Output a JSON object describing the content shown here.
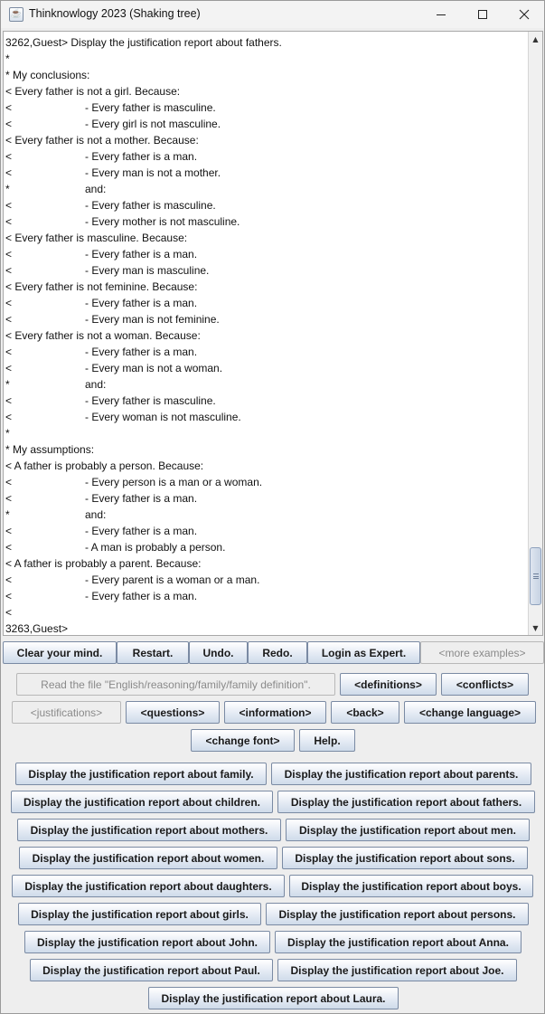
{
  "window": {
    "title": "Thinknowlogy 2023 (Shaking tree)",
    "app_icon_glyph": "☕"
  },
  "output": {
    "lines": [
      {
        "p": "3262,Guest> Display the justification report about fathers.",
        "t": ""
      },
      {
        "p": "*",
        "t": ""
      },
      {
        "p": "* My conclusions:",
        "t": ""
      },
      {
        "p": "< Every father is not a girl. Because:",
        "t": ""
      },
      {
        "p": "<",
        "t": "- Every father is masculine."
      },
      {
        "p": "<",
        "t": "- Every girl is not masculine."
      },
      {
        "p": "< Every father is not a mother. Because:",
        "t": ""
      },
      {
        "p": "<",
        "t": "- Every father is a man."
      },
      {
        "p": "<",
        "t": "- Every man is not a mother."
      },
      {
        "p": "*",
        "t": "and:"
      },
      {
        "p": "<",
        "t": "- Every father is masculine."
      },
      {
        "p": "<",
        "t": "- Every mother is not masculine."
      },
      {
        "p": "< Every father is masculine. Because:",
        "t": ""
      },
      {
        "p": "<",
        "t": "- Every father is a man."
      },
      {
        "p": "<",
        "t": "- Every man is masculine."
      },
      {
        "p": "< Every father is not feminine. Because:",
        "t": ""
      },
      {
        "p": "<",
        "t": "- Every father is a man."
      },
      {
        "p": "<",
        "t": "- Every man is not feminine."
      },
      {
        "p": "< Every father is not a woman. Because:",
        "t": ""
      },
      {
        "p": "<",
        "t": "- Every father is a man."
      },
      {
        "p": "<",
        "t": "- Every man is not a woman."
      },
      {
        "p": "*",
        "t": "and:"
      },
      {
        "p": "<",
        "t": "- Every father is masculine."
      },
      {
        "p": "<",
        "t": "- Every woman is not masculine."
      },
      {
        "p": "*",
        "t": ""
      },
      {
        "p": "* My assumptions:",
        "t": ""
      },
      {
        "p": "< A father is probably a person. Because:",
        "t": ""
      },
      {
        "p": "<",
        "t": "- Every person is a man or a woman."
      },
      {
        "p": "<",
        "t": "- Every father is a man."
      },
      {
        "p": "*",
        "t": "and:"
      },
      {
        "p": "<",
        "t": "- Every father is a man."
      },
      {
        "p": "<",
        "t": "- A man is probably a person."
      },
      {
        "p": "< A father is probably a parent. Because:",
        "t": ""
      },
      {
        "p": "<",
        "t": "- Every parent is a woman or a man."
      },
      {
        "p": "<",
        "t": "- Every father is a man."
      },
      {
        "p": "<",
        "t": ""
      },
      {
        "p": "3263,Guest>",
        "t": ""
      }
    ],
    "scroll_position": 0.97,
    "visible_fraction": 0.1
  },
  "toolbar": {
    "clear": "Clear your mind.",
    "restart": "Restart.",
    "undo": "Undo.",
    "redo": "Redo.",
    "login": "Login as Expert.",
    "more": "<more examples>"
  },
  "commands": {
    "read_file": "Read the file \"English/reasoning/family/family definition\".",
    "definitions": "<definitions>",
    "conflicts": "<conflicts>",
    "justifications": "<justifications>",
    "questions": "<questions>",
    "information": "<information>",
    "back": "<back>",
    "change_language": "<change language>",
    "change_font": "<change font>",
    "help": "Help."
  },
  "reports": [
    "Display the justification report about family.",
    "Display the justification report about parents.",
    "Display the justification report about children.",
    "Display the justification report about fathers.",
    "Display the justification report about mothers.",
    "Display the justification report about men.",
    "Display the justification report about women.",
    "Display the justification report about sons.",
    "Display the justification report about daughters.",
    "Display the justification report about boys.",
    "Display the justification report about girls.",
    "Display the justification report about persons.",
    "Display the justification report about John.",
    "Display the justification report about Anna.",
    "Display the justification report about Paul.",
    "Display the justification report about Joe.",
    "Display the justification report about Laura."
  ]
}
